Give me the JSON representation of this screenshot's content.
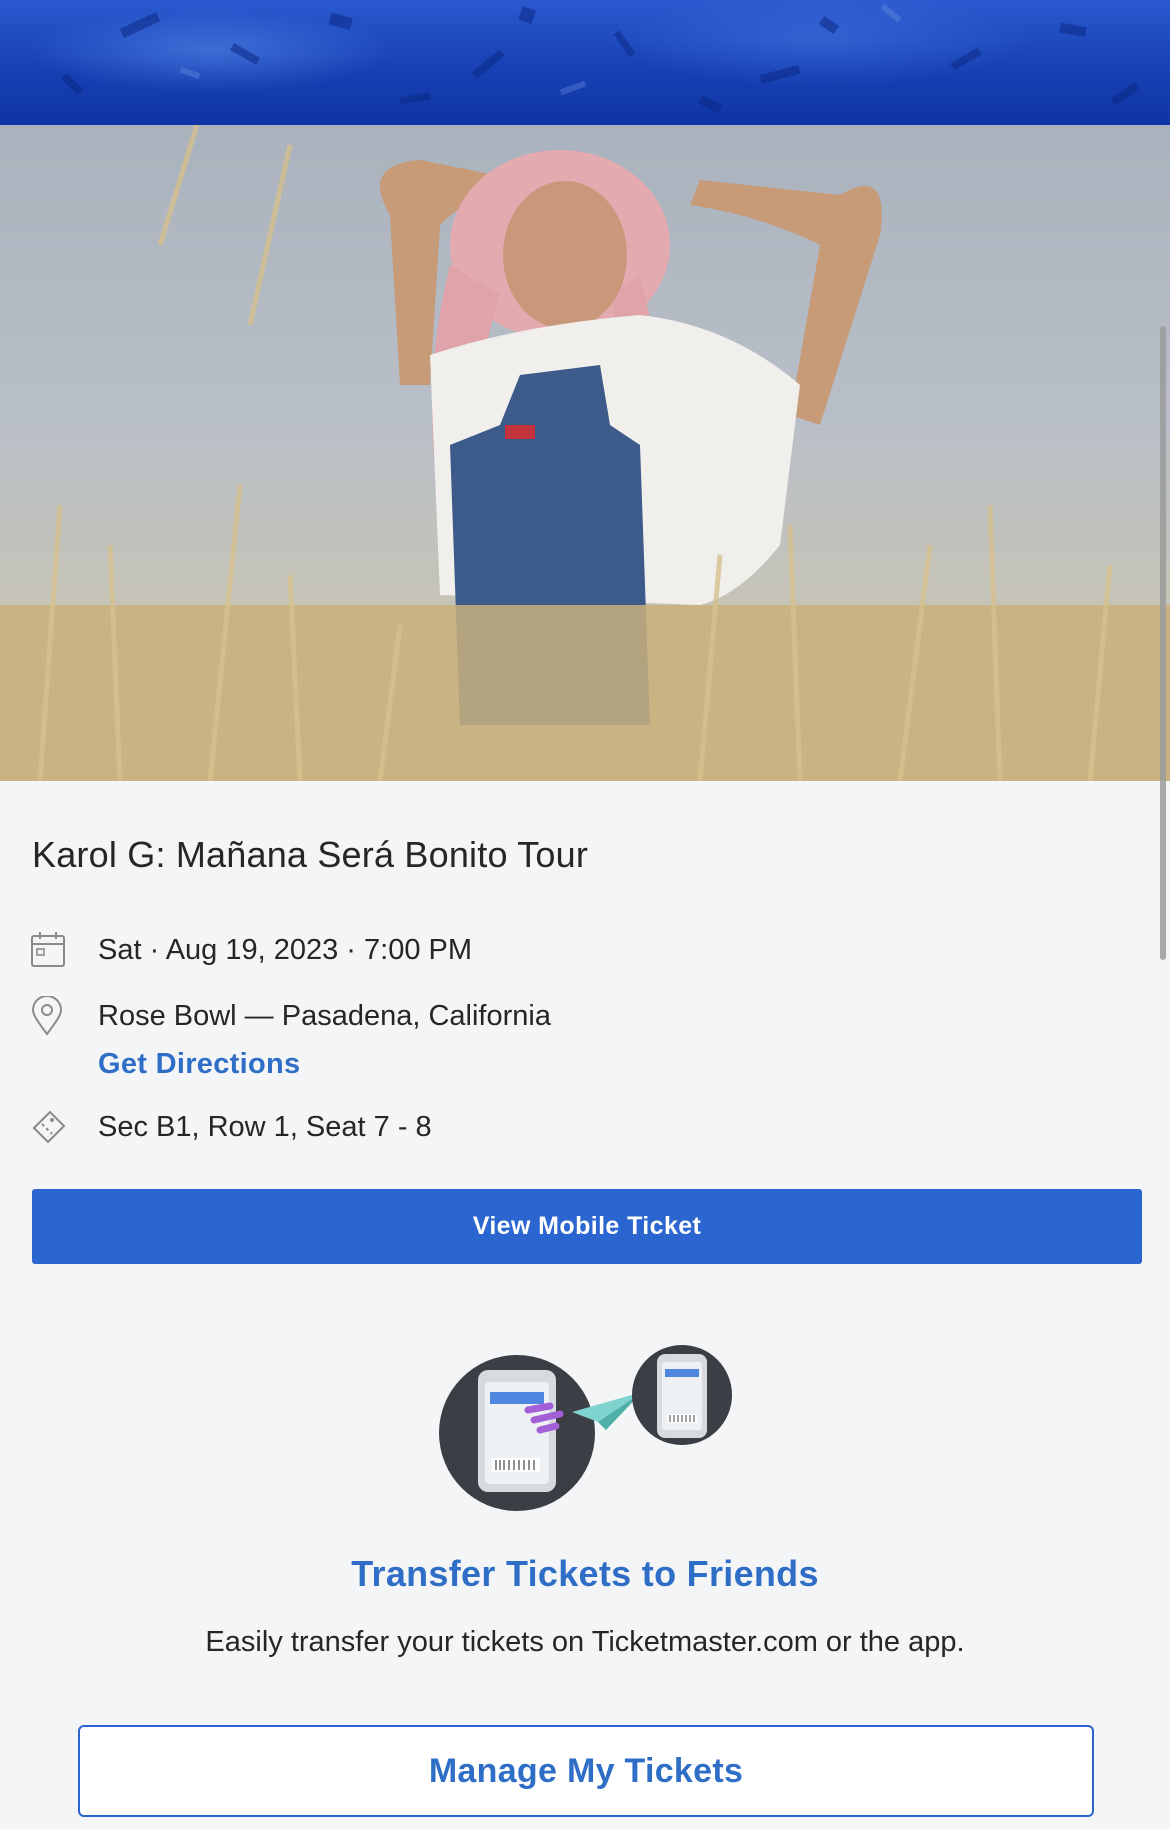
{
  "header": {
    "banner_icon": "confetti-pattern"
  },
  "hero": {
    "image_alt": "photo-of-artist-in-field"
  },
  "event": {
    "title": "Karol G: Mañana Será Bonito Tour",
    "datetime": "Sat · Aug 19, 2023 · 7:00 PM",
    "venue": "Rose Bowl — Pasadena, California",
    "directions_label": "Get Directions",
    "seats": "Sec B1, Row 1, Seat 7 - 8"
  },
  "actions": {
    "view_ticket_label": "View Mobile Ticket",
    "manage_label": "Manage My Tickets"
  },
  "transfer": {
    "title": "Transfer Tickets to Friends",
    "subtitle": "Easily transfer your tickets on Ticketmaster.com or the app."
  },
  "colors": {
    "accent": "#2b65cf",
    "link": "#2f6ec6",
    "banner": "#1741b4",
    "text": "#262626",
    "background": "#f4f5f6"
  }
}
